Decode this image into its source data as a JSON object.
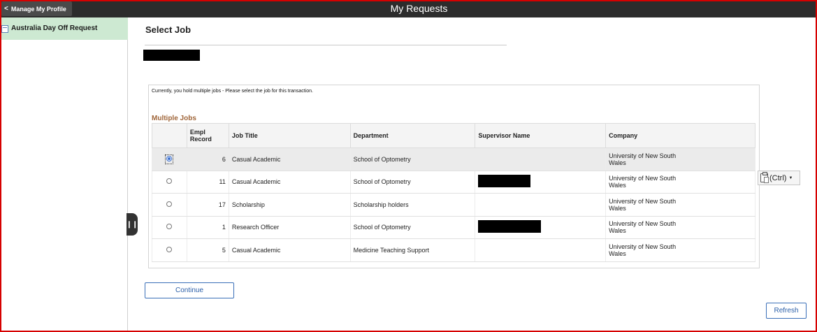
{
  "header": {
    "back_label": "Manage My Profile",
    "title": "My Requests"
  },
  "sidebar": {
    "items": [
      {
        "label": "Australia Day Off Request",
        "icon": "document-icon",
        "selected": true
      }
    ]
  },
  "page": {
    "title": "Select Job",
    "instructions": "Currently, you hold multiple jobs - Please select the job for this transaction."
  },
  "grid": {
    "title": "Multiple Jobs",
    "columns": [
      "",
      "Empl Record",
      "Job Title",
      "Department",
      "Supervisor Name",
      "Company"
    ],
    "rows": [
      {
        "selected": true,
        "empl_record": "6",
        "job_title": "Casual Academic",
        "department": "School of Optometry",
        "supervisor_redacted": false,
        "company": "University of New South Wales"
      },
      {
        "selected": false,
        "empl_record": "11",
        "job_title": "Casual Academic",
        "department": "School of Optometry",
        "supervisor_redacted": true,
        "company": "University of New South Wales"
      },
      {
        "selected": false,
        "empl_record": "17",
        "job_title": "Scholarship",
        "department": "Scholarship holders",
        "supervisor_redacted": false,
        "company": "University of New South Wales"
      },
      {
        "selected": false,
        "empl_record": "1",
        "job_title": "Research Officer",
        "department": "School of Optometry",
        "supervisor_redacted": true,
        "company": "University of New South Wales"
      },
      {
        "selected": false,
        "empl_record": "5",
        "job_title": "Casual Academic",
        "department": "Medicine Teaching Support",
        "supervisor_redacted": false,
        "company": "University of New South Wales"
      }
    ]
  },
  "buttons": {
    "continue": "Continue",
    "refresh": "Refresh"
  },
  "paste_options": {
    "label": "(Ctrl)",
    "icon": "clipboard-icon"
  },
  "colors": {
    "header_bg": "#2c2c2c",
    "sidebar_selected_bg": "#cde9d2",
    "grid_title": "#a0663a",
    "button_border": "#3a6fb8",
    "frame_border": "#d60000"
  }
}
